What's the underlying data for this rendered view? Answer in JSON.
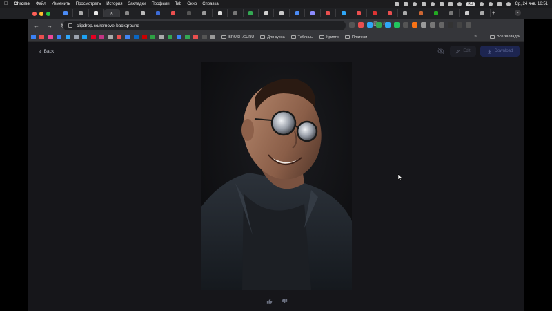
{
  "menubar": {
    "app_name": "Chrome",
    "menus": [
      "Файл",
      "Изменить",
      "Просмотреть",
      "История",
      "Закладки",
      "Профили",
      "Tab",
      "Окно",
      "Справка"
    ],
    "clock": "Ср, 24 янв.  16:51",
    "badge": "RU"
  },
  "browser": {
    "url": "clipdrop.co/remove-background",
    "tab_count": 28,
    "bookmark_folders": [
      "BRUSH.GURU",
      "Для курса",
      "Таблицы",
      "Крипто",
      "Платежи"
    ],
    "all_bookmarks_label": "Все закладки",
    "more_label": "»"
  },
  "page": {
    "back_label": "Back",
    "edit_label": "Edit",
    "download_label": "Download"
  },
  "colors": {
    "page_bg": "#16161a",
    "download_bg": "#1d2550"
  },
  "icons": [
    "apple-icon",
    "eye-off-icon",
    "pencil-icon",
    "download-icon",
    "thumbs-up-icon",
    "thumbs-down-icon",
    "star-icon",
    "translate-icon"
  ]
}
